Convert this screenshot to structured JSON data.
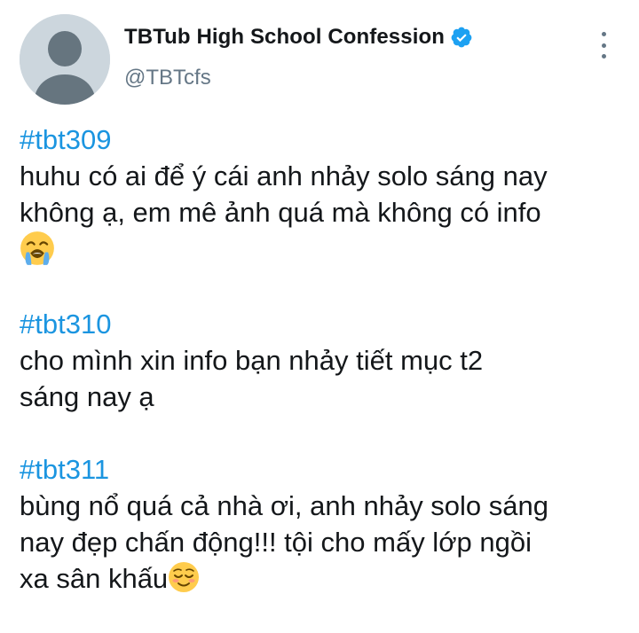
{
  "tweet": {
    "author": {
      "display_name": "TBTub High School Confession",
      "handle": "@TBTcfs",
      "verified": true,
      "avatar": "default-profile-icon"
    },
    "more_icon": "more-vertical-icon",
    "confessions": [
      {
        "hashtag": "#tbt309",
        "lines": [
          "huhu có ai để ý cái anh nhảy solo sáng nay",
          "không ạ, em mê ảnh quá mà không có info",
          ""
        ],
        "emoji": "loudly-crying-face-emoji"
      },
      {
        "hashtag": "#tbt310",
        "lines": [
          "cho mình xin info bạn nhảy tiết mục t2",
          "sáng nay ạ"
        ]
      },
      {
        "hashtag": "#tbt311",
        "lines": [
          "bùng nổ quá cả nhà ơi, anh nhảy solo sáng",
          "nay đẹp chấn động!!! tội cho mấy lớp ngồi",
          "xa sân khấu"
        ],
        "emoji": "relieved-face-emoji"
      }
    ]
  },
  "colors": {
    "hashtag": "#1b95e0",
    "verified_badge": "#1da1f2",
    "secondary_text": "#657786",
    "primary_text": "#14171a",
    "avatar_bg": "#ccd6dd",
    "avatar_figure": "#66757f"
  }
}
